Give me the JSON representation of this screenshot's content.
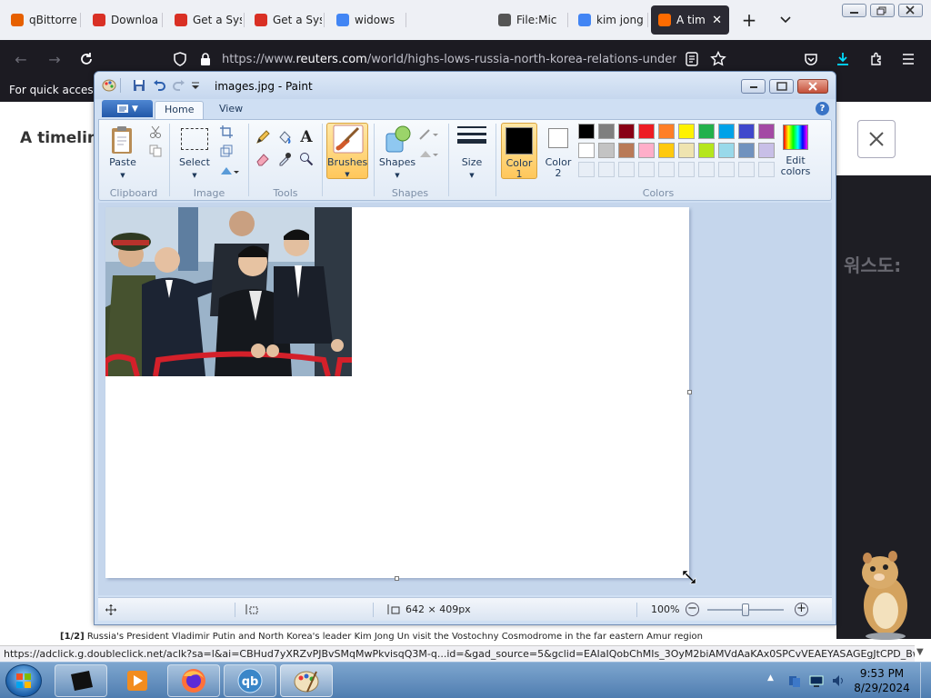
{
  "browser": {
    "tabs": [
      {
        "label": "qBittorre",
        "fav_color": "#e66000"
      },
      {
        "label": "Downloa",
        "fav_color": "#d93025"
      },
      {
        "label": "Get a Sys",
        "fav_color": "#d93025"
      },
      {
        "label": "Get a Sys",
        "fav_color": "#d93025"
      },
      {
        "label": "widows",
        "fav_color": "#4285f4"
      },
      {
        "label": "File:Mic",
        "fav_color": "#555555"
      },
      {
        "label": "kim jong",
        "fav_color": "#4285f4"
      },
      {
        "label": "A tim",
        "fav_color": "#ff6b00"
      }
    ],
    "url_prefix": "https://www.",
    "url_domain": "reuters.com",
    "url_path": "/world/highs-lows-russia-north-korea-relations-under-pu",
    "bookmarks_text": "For quick access,",
    "page_title": "A timelin",
    "korean_text": "워스도:",
    "caption_num": "[1/2]",
    "caption_text": "Russia's President Vladimir Putin and North Korea's leader Kim Jong Un visit the Vostochny Cosmodrome in the far eastern Amur region",
    "status_url": "https://adclick.g.doubleclick.net/aclk?sa=l&ai=CBHud7yXRZvPJBvSMqMwPkvisqQ3M-q...id=&gad_source=5&gclid=EAIaIQobChMIs_3OyM2biAMVdAaKAx0SPCvVEAEYASAGEgJtCPD_BwE"
  },
  "paint": {
    "title": "images.jpg - Paint",
    "tabs": [
      "Home",
      "View"
    ],
    "groups": {
      "clipboard": "Clipboard",
      "image": "Image",
      "tools": "Tools",
      "shapes": "Shapes",
      "colors": "Colors"
    },
    "buttons": {
      "paste": "Paste",
      "select": "Select",
      "brushes": "Brushes",
      "shapes": "Shapes",
      "size": "Size",
      "color1": "Color\n1",
      "color2": "Color\n2",
      "edit_colors": "Edit\ncolors"
    },
    "palette_row1": [
      "#000000",
      "#7f7f7f",
      "#880015",
      "#ed1c24",
      "#ff7f27",
      "#fff200",
      "#22b14c",
      "#00a2e8",
      "#3f48cc",
      "#a349a4"
    ],
    "palette_row2": [
      "#ffffff",
      "#c3c3c3",
      "#b97a57",
      "#ffaec9",
      "#ffc90e",
      "#efe4b0",
      "#b5e61d",
      "#99d9ea",
      "#7092be",
      "#c8bfe7"
    ],
    "selected_color1": "#000000",
    "selected_color2": "#ffffff",
    "dimensions": "642 × 409px",
    "zoom": "100%",
    "zoom_fraction": 0.5
  },
  "taskbar": {
    "time": "9:53 PM",
    "date": "8/29/2024"
  }
}
